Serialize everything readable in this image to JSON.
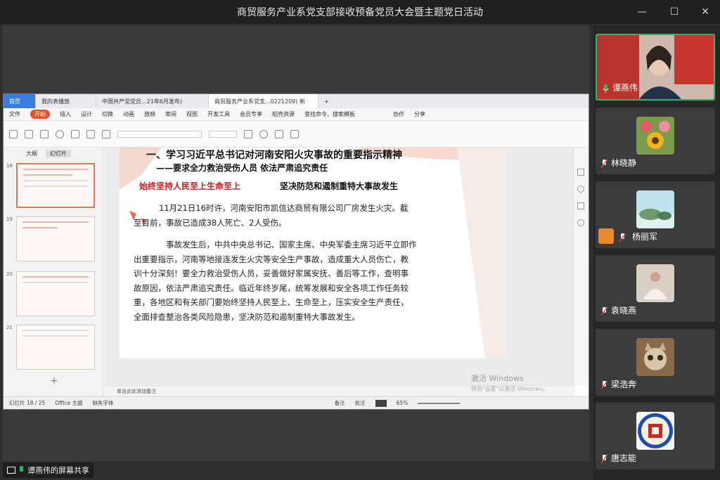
{
  "window": {
    "title": "商贸服务产业系党支部接收预备党员大会暨主题党日活动"
  },
  "wps": {
    "tabs": [
      "首页",
      "我的表播放",
      "中国共产党党员...21年6月发布)",
      "商贸服务产业系党支...0221209) 新"
    ],
    "menu": [
      "文件",
      "开始",
      "插入",
      "设计",
      "切换",
      "动画",
      "放映",
      "审阅",
      "视图",
      "开发工具",
      "会员专享",
      "稻壳资源",
      "查找命令、搜索模板",
      "协作",
      "分享"
    ],
    "thumb_tabs": [
      "大纲",
      "幻灯片"
    ],
    "slide_numbers": [
      "18",
      "19",
      "20",
      "21"
    ],
    "notes_placeholder": "单击此处添加备注",
    "status": {
      "slide_count": "幻灯片 18 / 25",
      "theme": "Office 主题",
      "font": "缺失字体",
      "notes": "备注",
      "comment": "批注",
      "zoom": "65%"
    },
    "watermark": {
      "line1": "激活 Windows",
      "line2": "转到\"设置\"以激活 Windows。"
    }
  },
  "slide": {
    "heading": "一、学习习近平总书记对河南安阳火灾事故的重要指示精神",
    "subheading": "——要求全力救治受伤人员  依法严肃追究责任",
    "red_line": "始终坚持人民至上生命至上",
    "black_line": "坚决防范和遏制重特大事故发生",
    "para1_lines": [
      "11月21日16时许，河南安阳市凯信达商贸有限公司厂房发生火灾。截",
      "至目前，事故已造成38人死亡、2人受伤。"
    ],
    "para2_lines": [
      "事故发生后，中共中央总书记、国家主席、中央军委主席习近平立即作",
      "出重要指示，河南等地接连发生火灾等安全生产事故，造成重大人员伤亡，教",
      "训十分深刻！要全力救治受伤人员，妥善做好家属安抚、善后等工作，查明事",
      "故原因，依法严肃追究责任。临近年终岁尾，统筹发展和安全各项工作任务较",
      "重，各地区和有关部门要始终坚持人民至上、生命至上，压实安全生产责任，",
      "全面排查整治各类风险隐患，坚决防范和遏制重特大事故发生。"
    ]
  },
  "participants": [
    {
      "name": "谭燕伟",
      "speaking": true
    },
    {
      "name": "林晓静",
      "speaking": false
    },
    {
      "name": "杨丽军",
      "speaking": false
    },
    {
      "name": "袁晓燕",
      "speaking": false
    },
    {
      "name": "梁浩奔",
      "speaking": false
    },
    {
      "name": "唐志能",
      "speaking": false
    }
  ],
  "share_label": "谭燕伟的屏幕共享",
  "colors": {
    "accent": "#2fb46b",
    "title_red": "#d8161a",
    "wps_blue": "#3a7de0"
  }
}
